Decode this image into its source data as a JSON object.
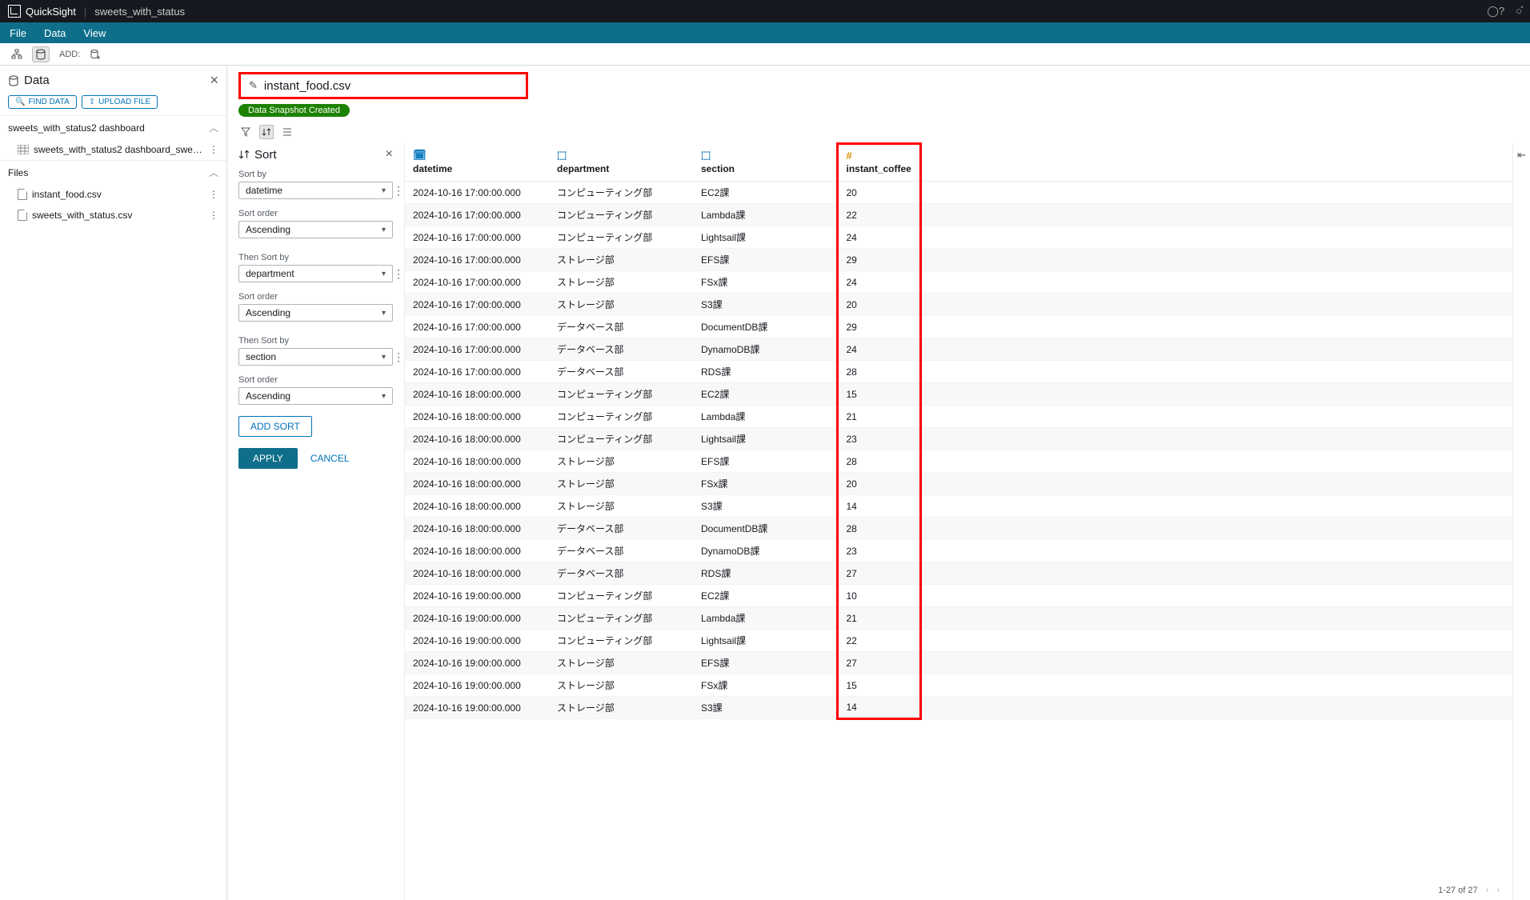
{
  "topbar": {
    "brand": "QuickSight",
    "project": "sweets_with_status"
  },
  "menubar": {
    "file": "File",
    "data": "Data",
    "view": "View"
  },
  "toolbar": {
    "add": "ADD:"
  },
  "left": {
    "title": "Data",
    "find": "FIND DATA",
    "upload": "UPLOAD FILE",
    "dashboard_section": "sweets_with_status2 dashboard",
    "dashboard_item": "sweets_with_status2 dashboard_sweets_with...",
    "files_section": "Files",
    "files": [
      "instant_food.csv",
      "sweets_with_status.csv"
    ]
  },
  "editor": {
    "filename": "instant_food.csv",
    "badge": "Data Snapshot Created"
  },
  "sort": {
    "title": "Sort",
    "sort_by_label": "Sort by",
    "sort_order_label": "Sort order",
    "then_sort_by_label": "Then Sort by",
    "fields": [
      {
        "by": "datetime",
        "order": "Ascending"
      },
      {
        "by": "department",
        "order": "Ascending"
      },
      {
        "by": "section",
        "order": "Ascending"
      }
    ],
    "add_sort": "ADD SORT",
    "apply": "APPLY",
    "cancel": "CANCEL"
  },
  "table": {
    "columns": {
      "datetime": "datetime",
      "department": "department",
      "section": "section",
      "instant_coffee": "instant_coffee"
    },
    "rows": [
      {
        "datetime": "2024-10-16 17:00:00.000",
        "department": "コンピューティング部",
        "section": "EC2課",
        "instant_coffee": "20"
      },
      {
        "datetime": "2024-10-16 17:00:00.000",
        "department": "コンピューティング部",
        "section": "Lambda課",
        "instant_coffee": "22"
      },
      {
        "datetime": "2024-10-16 17:00:00.000",
        "department": "コンピューティング部",
        "section": "Lightsail課",
        "instant_coffee": "24"
      },
      {
        "datetime": "2024-10-16 17:00:00.000",
        "department": "ストレージ部",
        "section": "EFS課",
        "instant_coffee": "29"
      },
      {
        "datetime": "2024-10-16 17:00:00.000",
        "department": "ストレージ部",
        "section": "FSx課",
        "instant_coffee": "24"
      },
      {
        "datetime": "2024-10-16 17:00:00.000",
        "department": "ストレージ部",
        "section": "S3課",
        "instant_coffee": "20"
      },
      {
        "datetime": "2024-10-16 17:00:00.000",
        "department": "データベース部",
        "section": "DocumentDB課",
        "instant_coffee": "29"
      },
      {
        "datetime": "2024-10-16 17:00:00.000",
        "department": "データベース部",
        "section": "DynamoDB課",
        "instant_coffee": "24"
      },
      {
        "datetime": "2024-10-16 17:00:00.000",
        "department": "データベース部",
        "section": "RDS課",
        "instant_coffee": "28"
      },
      {
        "datetime": "2024-10-16 18:00:00.000",
        "department": "コンピューティング部",
        "section": "EC2課",
        "instant_coffee": "15"
      },
      {
        "datetime": "2024-10-16 18:00:00.000",
        "department": "コンピューティング部",
        "section": "Lambda課",
        "instant_coffee": "21"
      },
      {
        "datetime": "2024-10-16 18:00:00.000",
        "department": "コンピューティング部",
        "section": "Lightsail課",
        "instant_coffee": "23"
      },
      {
        "datetime": "2024-10-16 18:00:00.000",
        "department": "ストレージ部",
        "section": "EFS課",
        "instant_coffee": "28"
      },
      {
        "datetime": "2024-10-16 18:00:00.000",
        "department": "ストレージ部",
        "section": "FSx課",
        "instant_coffee": "20"
      },
      {
        "datetime": "2024-10-16 18:00:00.000",
        "department": "ストレージ部",
        "section": "S3課",
        "instant_coffee": "14"
      },
      {
        "datetime": "2024-10-16 18:00:00.000",
        "department": "データベース部",
        "section": "DocumentDB課",
        "instant_coffee": "28"
      },
      {
        "datetime": "2024-10-16 18:00:00.000",
        "department": "データベース部",
        "section": "DynamoDB課",
        "instant_coffee": "23"
      },
      {
        "datetime": "2024-10-16 18:00:00.000",
        "department": "データベース部",
        "section": "RDS課",
        "instant_coffee": "27"
      },
      {
        "datetime": "2024-10-16 19:00:00.000",
        "department": "コンピューティング部",
        "section": "EC2課",
        "instant_coffee": "10"
      },
      {
        "datetime": "2024-10-16 19:00:00.000",
        "department": "コンピューティング部",
        "section": "Lambda課",
        "instant_coffee": "21"
      },
      {
        "datetime": "2024-10-16 19:00:00.000",
        "department": "コンピューティング部",
        "section": "Lightsail課",
        "instant_coffee": "22"
      },
      {
        "datetime": "2024-10-16 19:00:00.000",
        "department": "ストレージ部",
        "section": "EFS課",
        "instant_coffee": "27"
      },
      {
        "datetime": "2024-10-16 19:00:00.000",
        "department": "ストレージ部",
        "section": "FSx課",
        "instant_coffee": "15"
      },
      {
        "datetime": "2024-10-16 19:00:00.000",
        "department": "ストレージ部",
        "section": "S3課",
        "instant_coffee": "14"
      }
    ]
  },
  "footer": {
    "range": "1-27 of 27"
  }
}
